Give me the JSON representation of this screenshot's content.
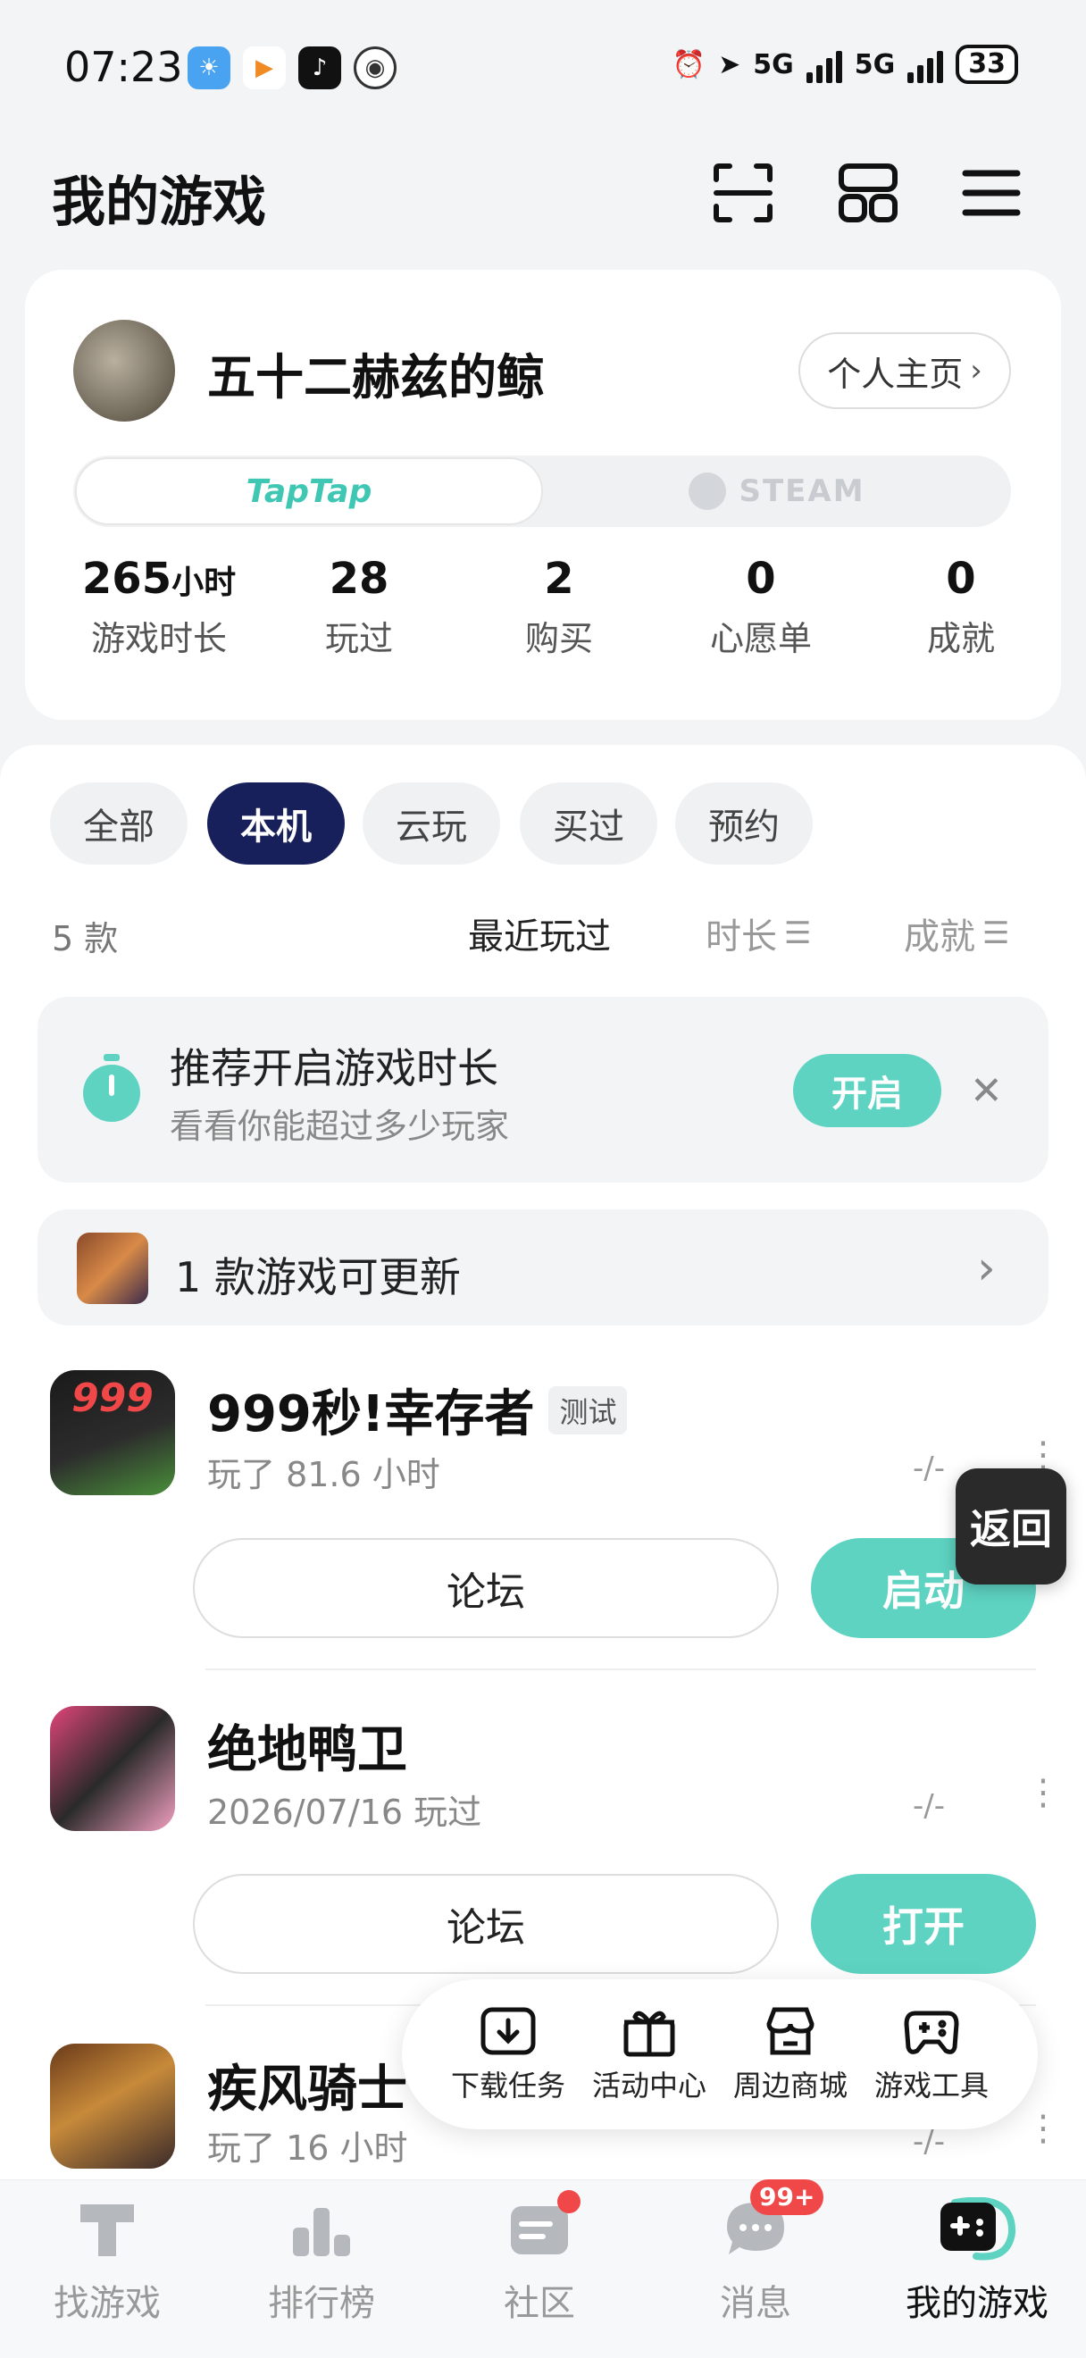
{
  "status_bar": {
    "time": "07:23",
    "network_1": "5G",
    "network_2": "5G",
    "battery": "33"
  },
  "header": {
    "title": "我的游戏"
  },
  "profile": {
    "username": "五十二赫兹的鲸",
    "homepage_label": "个人主页",
    "platforms": [
      "TapTap",
      "STEAM"
    ],
    "stats": [
      {
        "value": "265",
        "unit": "小时",
        "label": "游戏时长"
      },
      {
        "value": "28",
        "unit": "",
        "label": "玩过"
      },
      {
        "value": "2",
        "unit": "",
        "label": "购买"
      },
      {
        "value": "0",
        "unit": "",
        "label": "心愿单"
      },
      {
        "value": "0",
        "unit": "",
        "label": "成就"
      }
    ]
  },
  "filters": {
    "chips": [
      "全部",
      "本机",
      "云玩",
      "买过",
      "预约"
    ],
    "active": "本机",
    "count": "5 款",
    "sort_options": [
      "最近玩过",
      "时长",
      "成就"
    ]
  },
  "promo": {
    "title": "推荐开启游戏时长",
    "subtitle": "看看你能超过多少玩家",
    "button": "开启"
  },
  "update": {
    "text": "1 款游戏可更新"
  },
  "games": [
    {
      "name": "999秒!幸存者",
      "tag": "测试",
      "meta": "玩了 81.6 小时",
      "score": "-/-",
      "forum": "论坛",
      "action": "启动",
      "icon_text": "999"
    },
    {
      "name": "绝地鸭卫",
      "tag": "",
      "meta": "2026/07/16 玩过",
      "score": "-/-",
      "forum": "论坛",
      "action": "打开"
    },
    {
      "name": "疾风骑士",
      "tag": "",
      "meta": "玩了 16 小时",
      "score": "-/-"
    }
  ],
  "float_back": "返回",
  "toolbox": [
    "下载任务",
    "活动中心",
    "周边商城",
    "游戏工具"
  ],
  "tabbar": {
    "tabs": [
      "找游戏",
      "排行榜",
      "社区",
      "消息",
      "我的游戏"
    ],
    "active": "我的游戏",
    "message_badge": "99+"
  },
  "colors": {
    "accent": "#5ed3c2",
    "active_chip": "#17205a",
    "badge": "#f04848"
  }
}
